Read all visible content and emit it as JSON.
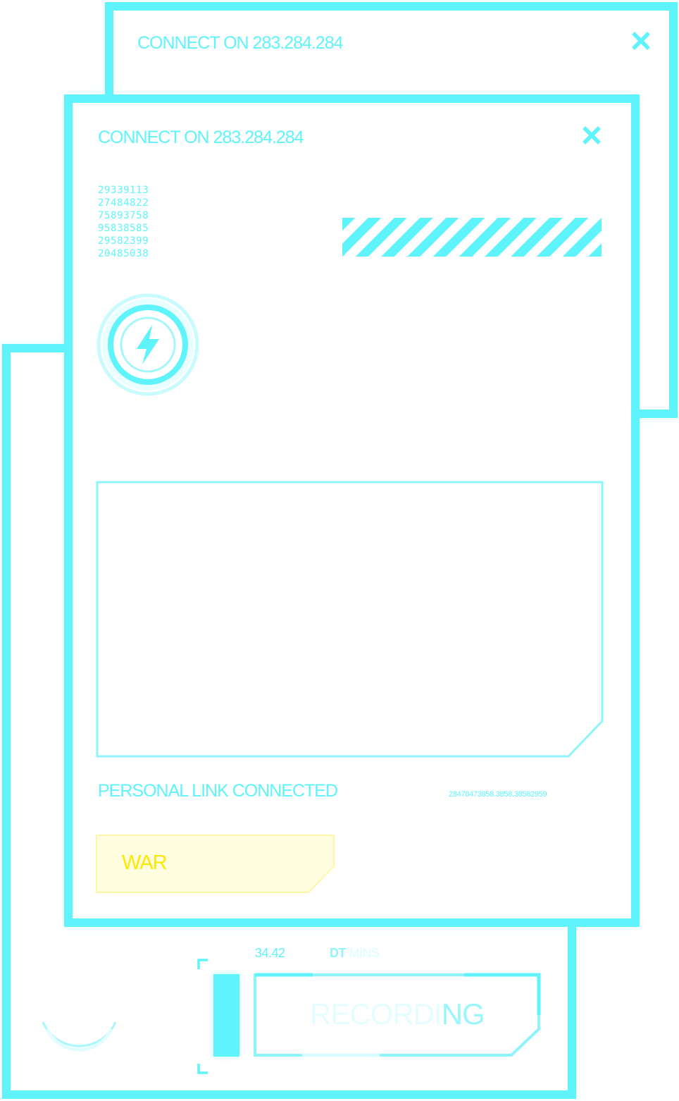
{
  "windows": {
    "back": {
      "title": "CONNECT ON 283.284.284"
    },
    "front": {
      "title": "CONNECT ON 283.284.284",
      "codes": [
        "29339113",
        "27484822",
        "75893758",
        "95838585",
        "29582399",
        "20485038"
      ],
      "link_status": "PERSONAL LINK CONNECTED",
      "link_id": "28478473858.3858.38582959",
      "tag_label": "WAR"
    },
    "recorder": {
      "speed": "34.42",
      "unit_bold": "DT",
      "unit_light": " MINS",
      "label_faint": "RECORDI",
      "label_bright": "NG",
      "level": 1.0
    }
  },
  "icons": {
    "close": "close-icon",
    "power": "lightning-bolt-icon"
  },
  "colors": {
    "accent": "#5ff3fb",
    "warning": "#fde900",
    "warning_bg": "#fefde0",
    "background": "#ffffff"
  }
}
